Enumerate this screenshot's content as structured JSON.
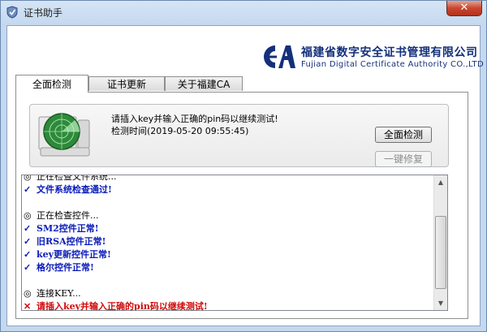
{
  "window": {
    "title": "证书助手",
    "close_label": "✕",
    "icon": "certificate-app-icon"
  },
  "brand": {
    "name_cn": "福建省数字安全证书管理有限公司",
    "name_en": "Fujian Digital Certificate Authority CO.,LTD",
    "logo_icon": "fjca-logo-icon",
    "color": "#14307a"
  },
  "tabs": [
    {
      "label": "全面检测",
      "active": true
    },
    {
      "label": "证书更新",
      "active": false
    },
    {
      "label": "关于福建CA",
      "active": false
    }
  ],
  "status": {
    "message": "请插入key并输入正确的pin码以继续测试!",
    "time": "检测时间(2019-05-20 09:55:45)",
    "icon": "radar-scanner-icon"
  },
  "buttons": {
    "full_check": "全面检测",
    "one_click_repair": "一键修复"
  },
  "log": [
    {
      "mark": "◎",
      "text": "正在检查文件系统...",
      "type": "plain"
    },
    {
      "mark": "✓",
      "text": "文件系统检查通过!",
      "type": "ok"
    },
    {
      "mark": "",
      "text": "",
      "type": "plain"
    },
    {
      "mark": "◎",
      "text": "正在检查控件...",
      "type": "plain"
    },
    {
      "mark": "✓",
      "text": "SM2控件正常!",
      "type": "ok"
    },
    {
      "mark": "✓",
      "text": "旧RSA控件正常!",
      "type": "ok"
    },
    {
      "mark": "✓",
      "text": "key更新控件正常!",
      "type": "ok"
    },
    {
      "mark": "✓",
      "text": "格尔控件正常!",
      "type": "ok"
    },
    {
      "mark": "",
      "text": "",
      "type": "plain"
    },
    {
      "mark": "◎",
      "text": "连接KEY...",
      "type": "plain"
    },
    {
      "mark": "✕",
      "text": "请插入key并输入正确的pin码以继续测试!",
      "type": "err"
    }
  ],
  "scrollbar": {
    "up": "▲",
    "down": "▼"
  }
}
